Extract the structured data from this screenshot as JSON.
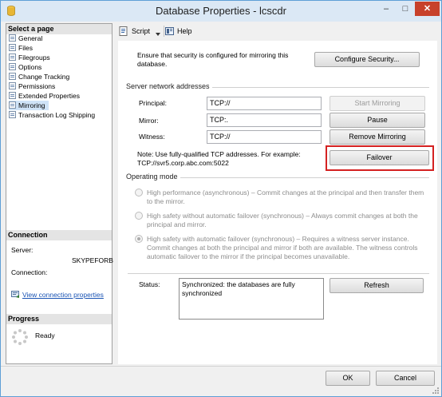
{
  "window": {
    "title": "Database Properties - lcscdr",
    "min_symbol": "–",
    "max_symbol": "□",
    "close_symbol": "✕"
  },
  "left_pane": {
    "select_header": "Select a page",
    "pages": [
      {
        "label": "General"
      },
      {
        "label": "Files"
      },
      {
        "label": "Filegroups"
      },
      {
        "label": "Options"
      },
      {
        "label": "Change Tracking"
      },
      {
        "label": "Permissions"
      },
      {
        "label": "Extended Properties"
      },
      {
        "label": "Mirroring"
      },
      {
        "label": "Transaction Log Shipping"
      }
    ],
    "selected_page": "Mirroring",
    "connection_header": "Connection",
    "server_label": "Server:",
    "server_value": "SKYPEFORB",
    "connection_label": "Connection:",
    "view_connection_link": "View connection properties",
    "progress_header": "Progress",
    "progress_status": "Ready"
  },
  "toolbar": {
    "script_label": "Script",
    "help_label": "Help"
  },
  "mirroring": {
    "security_note": "Ensure that security is configured for mirroring this database.",
    "configure_security_button": "Configure Security...",
    "addresses_group": "Server network addresses",
    "principal_label": "Principal:",
    "principal_value": "TCP://",
    "mirror_label": "Mirror:",
    "mirror_value": "TCP:.",
    "witness_label": "Witness:",
    "witness_value": "TCP://",
    "start_mirroring_button": "Start Mirroring",
    "pause_button": "Pause",
    "remove_mirroring_button": "Remove Mirroring",
    "failover_button": "Failover",
    "note_line1": "Note: Use fully-qualified TCP addresses. For example:",
    "note_line2": "TCP://svr5.corp.abc.com:5022",
    "operating_mode_group": "Operating mode",
    "options": [
      {
        "line1": "High performance (asynchronous) – Commit changes at the principal and then transfer them",
        "line2": "to the mirror.",
        "line3": "",
        "checked": false
      },
      {
        "line1": "High safety without automatic failover (synchronous) – Always commit changes at both the",
        "line2": "principal and mirror.",
        "line3": "",
        "checked": false
      },
      {
        "line1": "High safety with automatic failover (synchronous) – Requires a witness server instance.",
        "line2": "Commit changes at both the principal and mirror if both are available. The witness controls",
        "line3": "automatic failover to the mirror if the principal becomes unavailable.",
        "checked": true
      }
    ],
    "status_label": "Status:",
    "status_line1": "Synchronized: the databases are fully",
    "status_line2": "synchronized",
    "refresh_button": "Refresh"
  },
  "footer": {
    "ok_button": "OK",
    "cancel_button": "Cancel"
  },
  "colors": {
    "highlight_border": "#d42121",
    "selected_page_bg": "#cfe3f7",
    "link": "#1a54b4"
  }
}
